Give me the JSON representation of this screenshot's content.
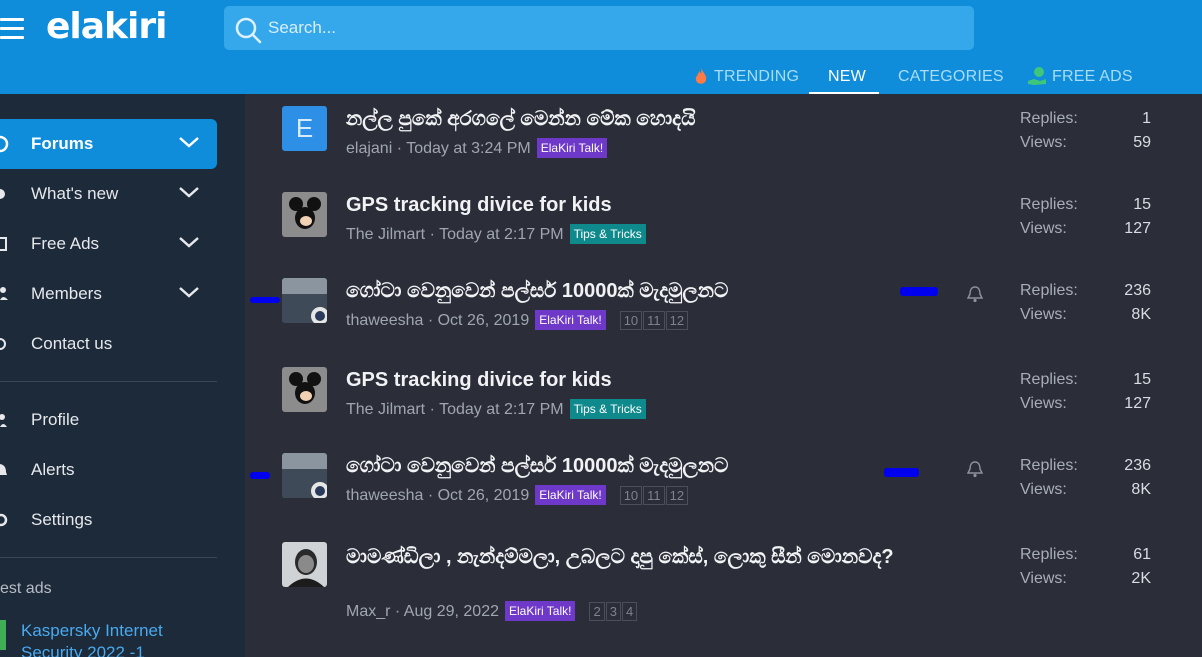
{
  "header": {
    "logo": "elakiri",
    "search_placeholder": "Search..."
  },
  "subnav": {
    "trending": "TRENDING",
    "new": "NEW",
    "categories": "CATEGORIES",
    "free_ads": "FREE ADS"
  },
  "sidebar": {
    "items": [
      {
        "label": "Forums"
      },
      {
        "label": "What's new"
      },
      {
        "label": "Free Ads"
      },
      {
        "label": "Members"
      },
      {
        "label": "Contact us"
      },
      {
        "label": "Profile"
      },
      {
        "label": "Alerts"
      },
      {
        "label": "Settings"
      }
    ],
    "latest_ads_heading": "est ads",
    "ad_link": "Kaspersky Internet Security 2022 -1"
  },
  "threads": [
    {
      "title": "නල්ල පුකේ අරගලේ මෙන්න මේක හොදයි",
      "author": "elajani",
      "date": "Today at 3:24 PM",
      "tag": "ElaKiri Talk!",
      "replies": "1",
      "views": "59",
      "avatar_letter": "E"
    },
    {
      "title": "GPS tracking divice for kids",
      "author": "The Jilmart",
      "date": "Today at 2:17 PM",
      "tag": "Tips & Tricks",
      "replies": "15",
      "views": "127"
    },
    {
      "title": "ගෝටා වෙනුවෙන් පල්සර් 10000ක් මැදමුලනට",
      "author": "thaweesha",
      "date": "Oct 26, 2019",
      "tag": "ElaKiri Talk!",
      "pages": [
        "10",
        "11",
        "12"
      ],
      "replies": "236",
      "views": "8K"
    },
    {
      "title": "GPS tracking divice for kids",
      "author": "The Jilmart",
      "date": "Today at 2:17 PM",
      "tag": "Tips & Tricks",
      "replies": "15",
      "views": "127"
    },
    {
      "title": "ගෝටා වෙනුවෙන් පල්සර් 10000ක් මැදමුලනට",
      "author": "thaweesha",
      "date": "Oct 26, 2019",
      "tag": "ElaKiri Talk!",
      "pages": [
        "10",
        "11",
        "12"
      ],
      "replies": "236",
      "views": "8K"
    },
    {
      "title": "මාමණ්ඩිලා , නැන්දම්මලා, උබලට දාපු කේස්, ලොකු සීන් මොනවද?",
      "author": "Max_r",
      "date": "Aug 29, 2022",
      "tag": "ElaKiri Talk!",
      "pages": [
        "2",
        "3",
        "4"
      ],
      "replies": "61",
      "views": "2K"
    }
  ],
  "labels": {
    "replies": "Replies:",
    "views": "Views:"
  },
  "colors": {
    "brand": "#0f8ddb",
    "tag_purple": "#6e38c8",
    "tag_teal": "#0e8a8c"
  }
}
